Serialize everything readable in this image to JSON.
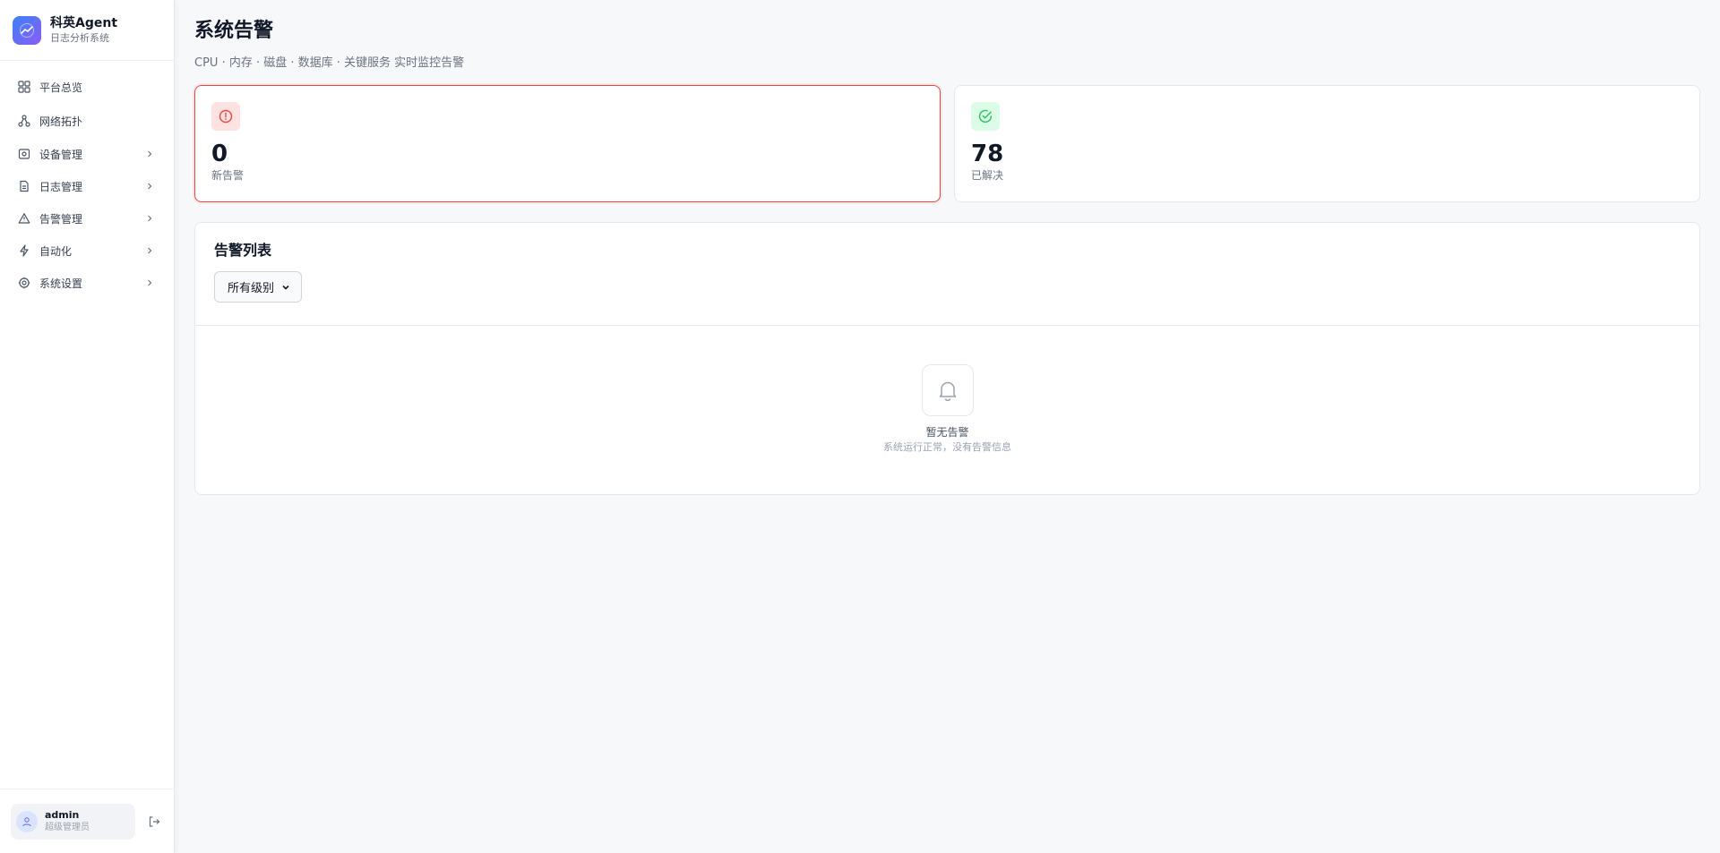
{
  "brand": {
    "title": "科英Agent",
    "subtitle": "日志分析系统"
  },
  "sidebar": {
    "items": [
      {
        "label": "平台总览",
        "icon": "grid-icon",
        "expandable": false
      },
      {
        "label": "网络拓扑",
        "icon": "network-icon",
        "expandable": false
      },
      {
        "label": "设备管理",
        "icon": "device-icon",
        "expandable": true
      },
      {
        "label": "日志管理",
        "icon": "file-icon",
        "expandable": true
      },
      {
        "label": "告警管理",
        "icon": "warning-icon",
        "expandable": true
      },
      {
        "label": "自动化",
        "icon": "lightning-icon",
        "expandable": true
      },
      {
        "label": "系统设置",
        "icon": "gear-icon",
        "expandable": true
      }
    ]
  },
  "user": {
    "name": "admin",
    "role": "超级管理员"
  },
  "page": {
    "title": "系统告警",
    "subtitle": "CPU · 内存 · 磁盘 · 数据库 · 关键服务 实时监控告警"
  },
  "stats": [
    {
      "value": "0",
      "label": "新告警",
      "icon": "alert-circle-icon",
      "accent": "#ef4444"
    },
    {
      "value": "78",
      "label": "已解决",
      "icon": "check-circle-icon",
      "accent": "#22c55e"
    }
  ],
  "alert_list": {
    "title": "告警列表",
    "filter_selected": "所有级别",
    "empty_title": "暂无告警",
    "empty_subtitle": "系统运行正常，没有告警信息"
  }
}
